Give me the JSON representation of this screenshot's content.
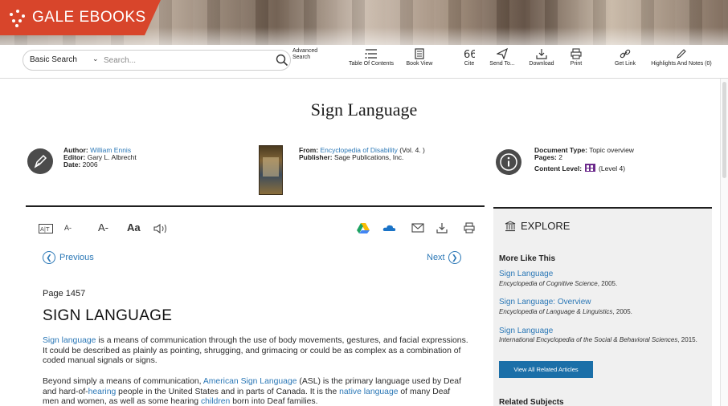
{
  "brand": {
    "name": "GALE EBOOKS"
  },
  "search": {
    "type_label": "Basic Search",
    "placeholder": "Search...",
    "advanced_label": "Advanced Search"
  },
  "toolbar": {
    "table_of_contents": "Table Of Contents",
    "book_view": "Book View",
    "cite": "Cite",
    "send_to": "Send To...",
    "download": "Download",
    "print": "Print",
    "get_link": "Get Link",
    "highlights": "Highlights And Notes (0)"
  },
  "document": {
    "title": "Sign Language",
    "author_label": "Author:",
    "author": "William Ennis",
    "editor_label": "Editor:",
    "editor": "Gary L. Albrecht",
    "date_label": "Date:",
    "date": "2006",
    "from_label": "From:",
    "from_title": "Encyclopedia of Disability",
    "from_volume": "(Vol. 4. )",
    "publisher_label": "Publisher:",
    "publisher": "Sage Publications, Inc.",
    "doc_type_label": "Document Type:",
    "doc_type": "Topic overview",
    "pages_label": "Pages:",
    "pages": "2",
    "content_level_label": "Content Level:",
    "content_level": "(Level 4)"
  },
  "article_tools": {
    "font_smaller": "A-",
    "font_larger": "A-",
    "font_style": "Aa"
  },
  "article": {
    "prev_label": "Previous",
    "next_label": "Next",
    "page_number": "Page 1457",
    "heading": "SIGN LANGUAGE",
    "p1_link": "Sign language",
    "p1_text": " is a means of communication through the use of body movements, gestures, and facial expressions. It could be described as plainly as pointing, shrugging, and grimacing or could be as complex as a combination of coded manual signals or signs.",
    "p2_a": "Beyond simply a means of communication, ",
    "p2_link1": "American Sign Language",
    "p2_b": " (ASL) is the primary language used by Deaf and hard-of-",
    "p2_link2": "hearing",
    "p2_c": " people in the United States and in parts of Canada. It is the ",
    "p2_link3": "native language",
    "p2_d": " of many Deaf men and women, as well as some hearing ",
    "p2_link4": "children",
    "p2_e": " born into Deaf families."
  },
  "explore": {
    "heading": "EXPLORE",
    "more_like_this": "More Like This",
    "related": [
      {
        "title": "Sign Language",
        "source": "Encyclopedia of Cognitive Science",
        "year": ", 2005."
      },
      {
        "title": "Sign Language: Overview",
        "source": "Encyclopedia of Language & Linguistics",
        "year": ", 2005."
      },
      {
        "title": "Sign Language",
        "source": "International Encyclopedia of the Social & Behavioral Sciences",
        "year": ", 2015."
      }
    ],
    "view_all": "View All Related Articles",
    "related_subjects": "Related Subjects"
  },
  "colors": {
    "brand": "#d8452b",
    "link": "#2a77b6",
    "button": "#1b6fa8",
    "sidebar_bg": "#f0f0f0"
  }
}
